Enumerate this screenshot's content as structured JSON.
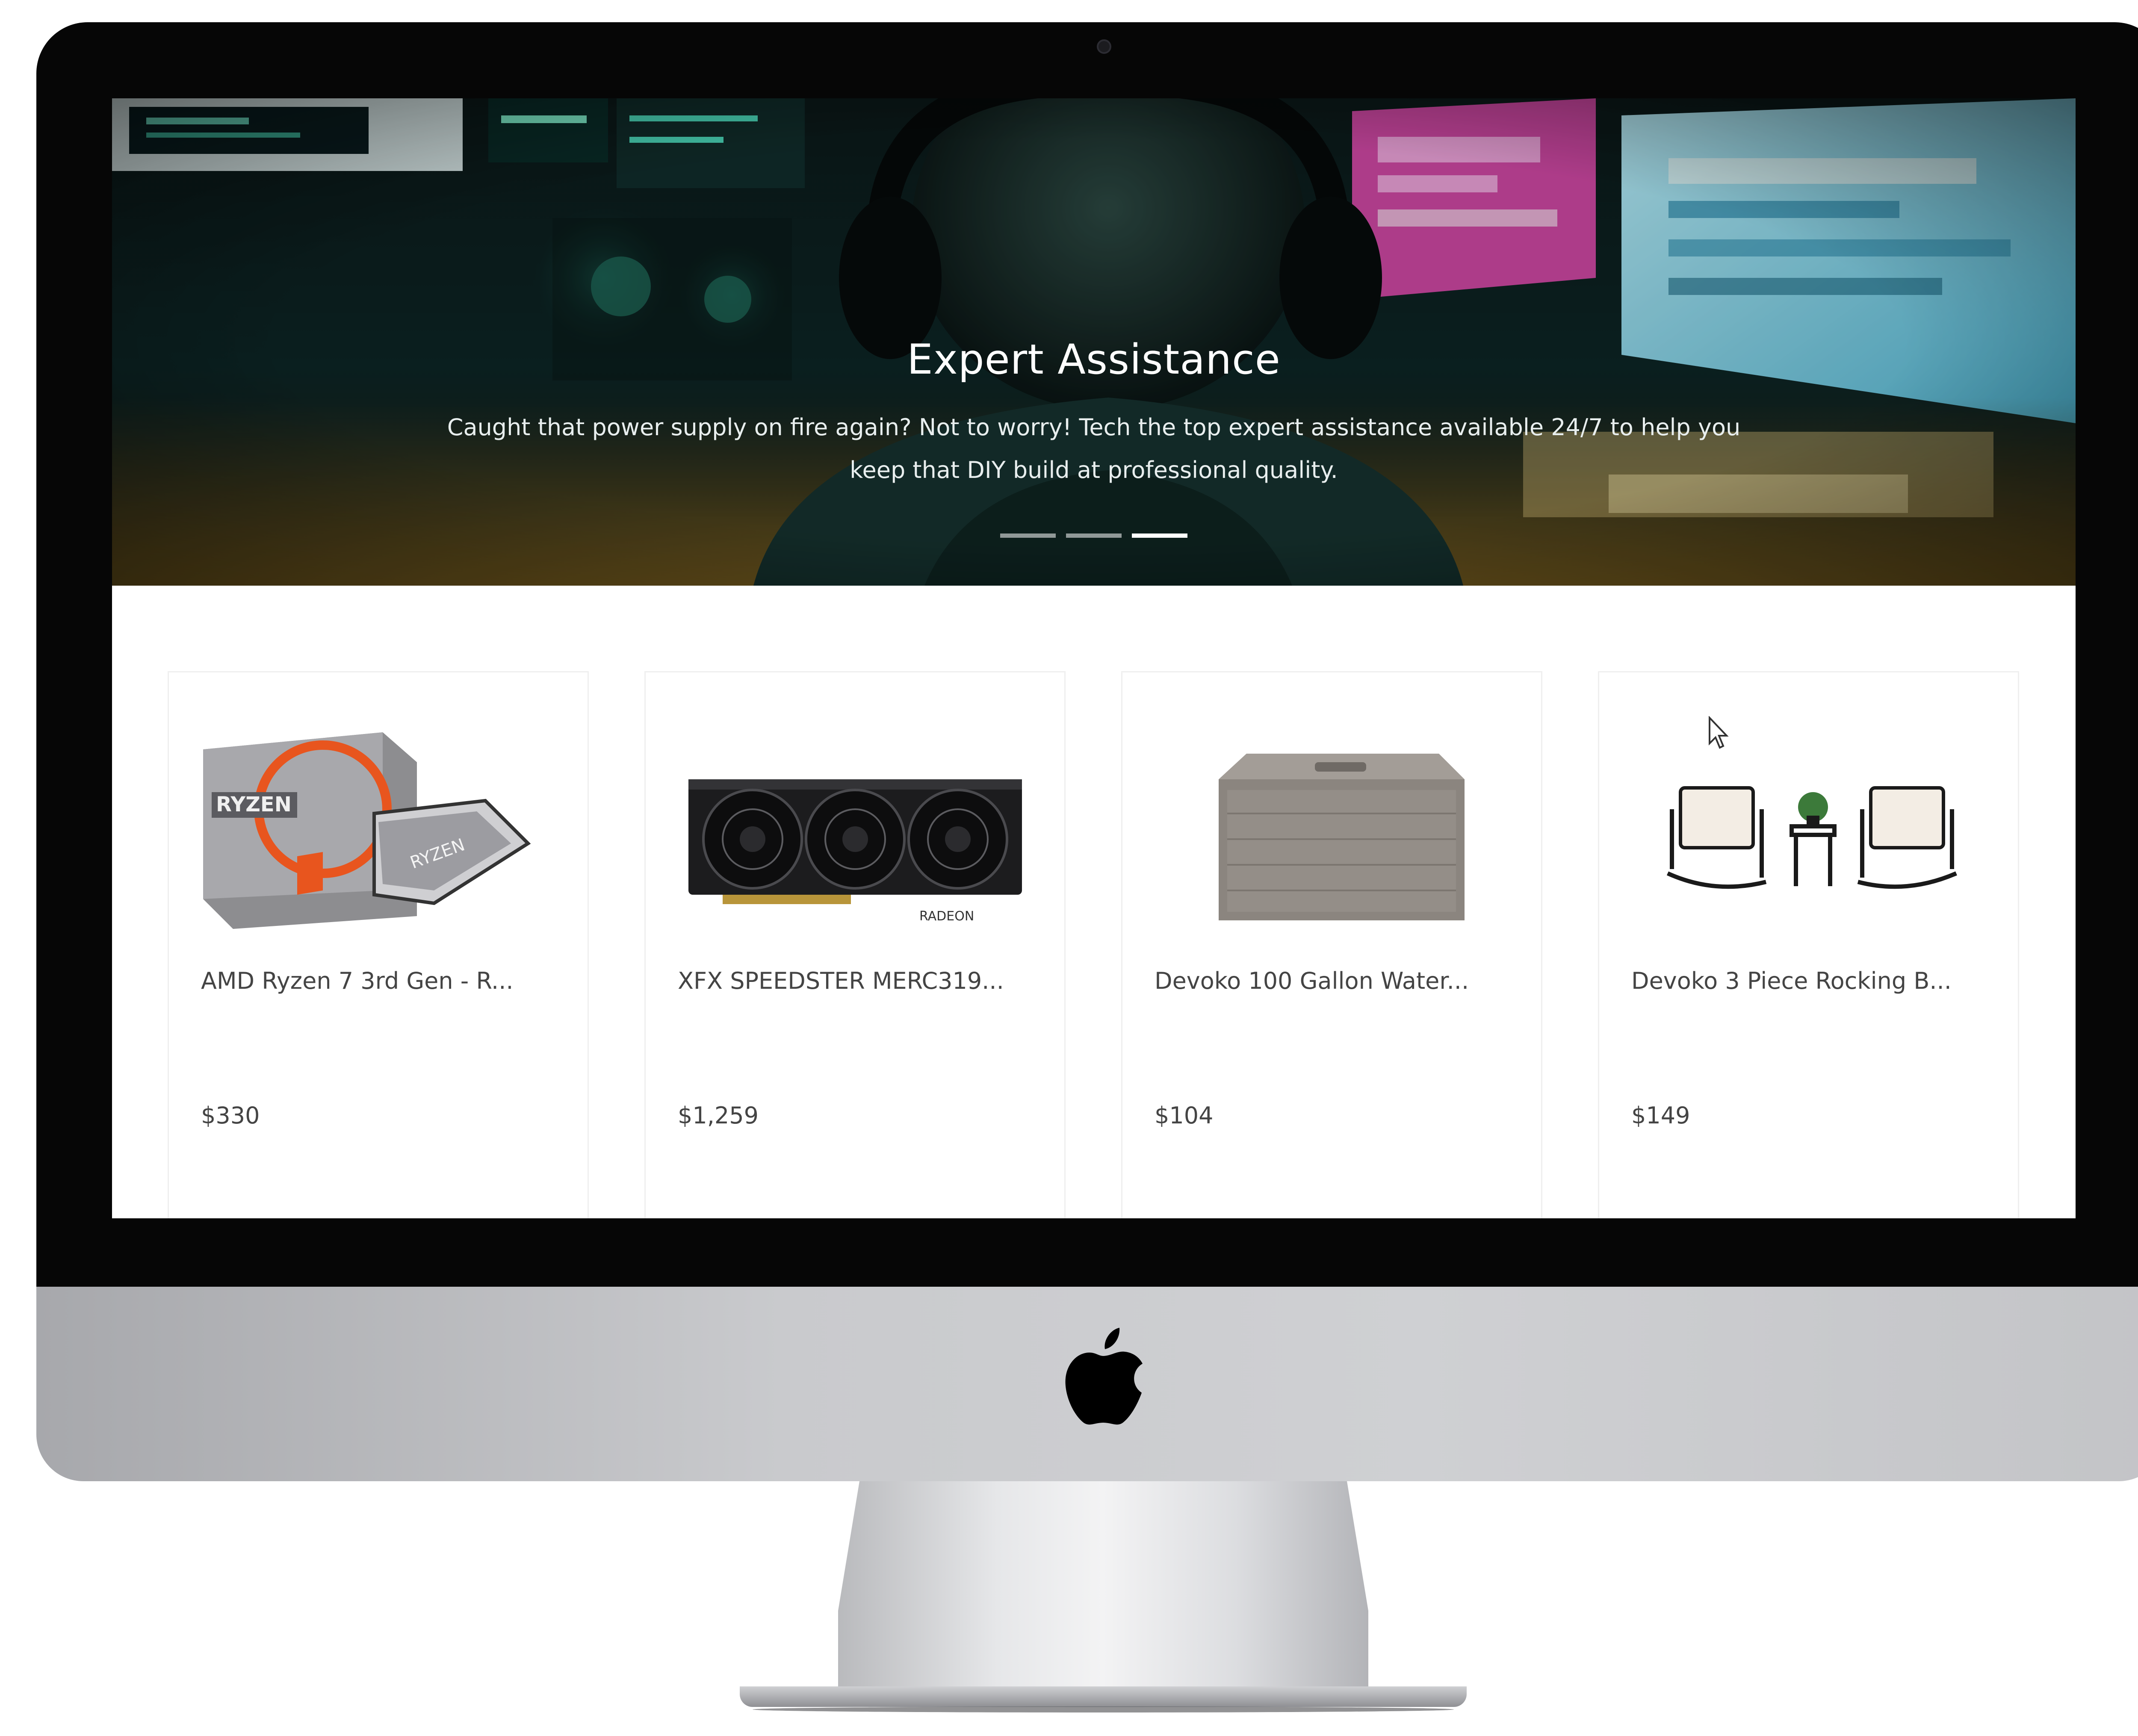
{
  "device": {
    "logo_icon": "apple-logo-icon",
    "camera_icon": "camera-icon"
  },
  "hero": {
    "title": "Expert Assistance",
    "description": "Caught that power supply on fire again? Not to worry! Tech the top expert assistance available 24/7 to help you keep that DIY build at professional quality.",
    "slide_count": 3,
    "active_slide": 3
  },
  "products": [
    {
      "name": "AMD Ryzen 7 3rd Gen - R...",
      "price": "$330",
      "image_icon": "cpu-box-image"
    },
    {
      "name": "XFX SPEEDSTER MERC319...",
      "price": "$1,259",
      "image_icon": "graphics-card-image"
    },
    {
      "name": "Devoko 100 Gallon Water...",
      "price": "$104",
      "image_icon": "storage-box-image"
    },
    {
      "name": "Devoko 3 Piece Rocking B...",
      "price": "$149",
      "image_icon": "rocking-chair-set-image"
    }
  ],
  "colors": {
    "bezel": "#060606",
    "chin": "#c9cacd",
    "text": "#444444",
    "card_border": "#efefef",
    "hero_text": "#ffffff"
  }
}
